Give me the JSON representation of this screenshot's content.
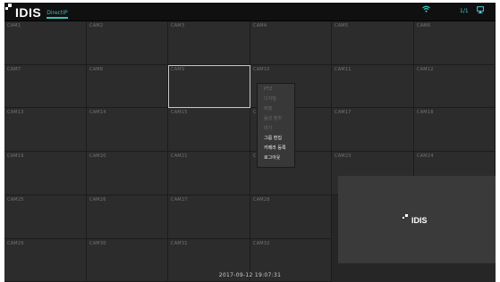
{
  "topbar": {
    "logo_text": "IDIS",
    "logo_sub": "DirectIP",
    "status_text": "1/1",
    "colors": {
      "accent": "#35c2b5",
      "wifi": "#2ed3c3",
      "monitor": "#4fc6d8"
    },
    "icons": [
      "wifi-icon",
      "monitor-icon"
    ]
  },
  "cameras": [
    {
      "label": "CAM1"
    },
    {
      "label": "CAM2"
    },
    {
      "label": "CAM3"
    },
    {
      "label": "CAM4"
    },
    {
      "label": "CAM5"
    },
    {
      "label": "CAM6"
    },
    {
      "label": "CAM7"
    },
    {
      "label": "CAM8"
    },
    {
      "label": "CAM9",
      "selected": true
    },
    {
      "label": "CAM10"
    },
    {
      "label": "CAM11"
    },
    {
      "label": "CAM12"
    },
    {
      "label": "CAM13"
    },
    {
      "label": "CAM14"
    },
    {
      "label": "CAM15"
    },
    {
      "label": "CAM16"
    },
    {
      "label": "CAM17"
    },
    {
      "label": "CAM18"
    },
    {
      "label": "CAM19"
    },
    {
      "label": "CAM20"
    },
    {
      "label": "CAM21"
    },
    {
      "label": "CAM22"
    },
    {
      "label": "CAM23"
    },
    {
      "label": "CAM24"
    },
    {
      "label": "CAM25"
    },
    {
      "label": "CAM26"
    },
    {
      "label": "CAM27"
    },
    {
      "label": "CAM28"
    },
    {
      "label": "CAM29"
    },
    {
      "label": "CAM30"
    },
    {
      "label": "CAM31"
    },
    {
      "label": "CAM32"
    }
  ],
  "logo_panel": {
    "text": "IDIS"
  },
  "context_menu": [
    {
      "label": "PTZ",
      "enabled": false
    },
    {
      "label": "디지털",
      "enabled": false
    },
    {
      "label": "화질",
      "enabled": false
    },
    {
      "label": "음성 청취",
      "enabled": false
    },
    {
      "label": "대기",
      "enabled": false
    },
    {
      "label": "그룹 편집",
      "enabled": true
    },
    {
      "label": "카메라 등록",
      "enabled": true
    },
    {
      "label": "로그아웃",
      "enabled": true
    }
  ],
  "datetime": "2017-09-12 19:07:31"
}
